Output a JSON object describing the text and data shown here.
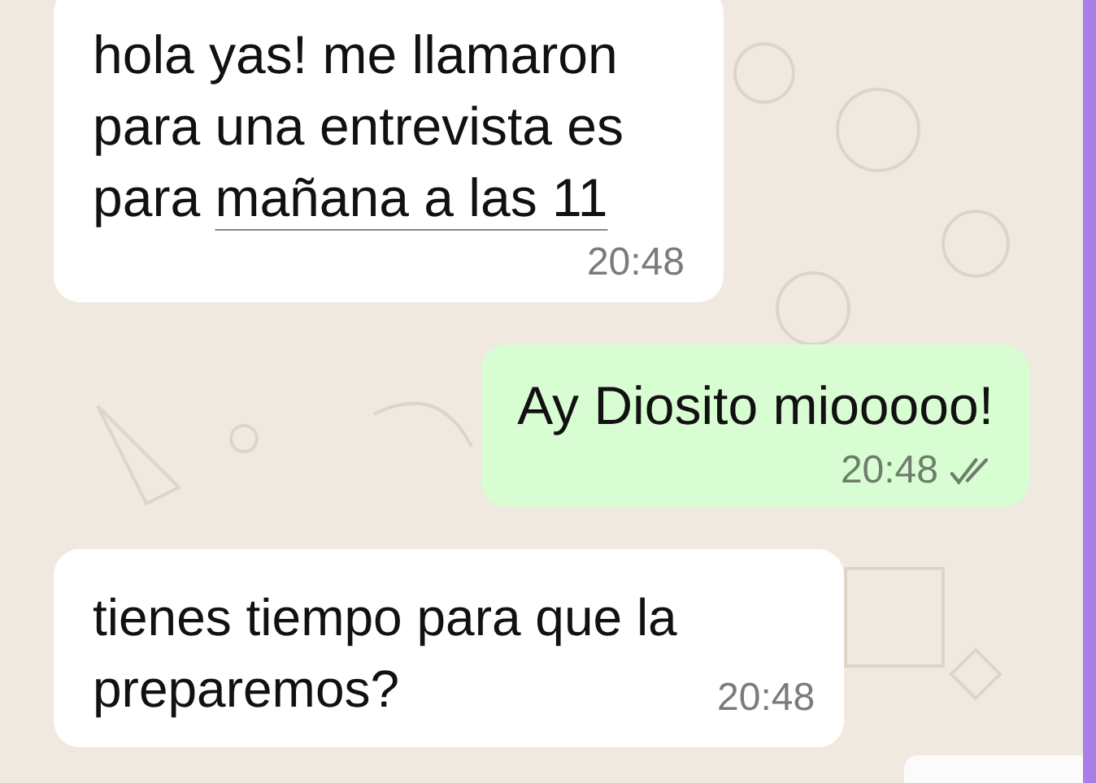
{
  "messages": [
    {
      "outgoing": false,
      "parts": [
        {
          "kind": "plain",
          "text": "hola yas! me llamaron para una entrevista es para "
        },
        {
          "kind": "date-link",
          "text": "mañana a las 11"
        }
      ],
      "time": "20:48"
    },
    {
      "outgoing": true,
      "parts": [
        {
          "kind": "plain",
          "text": "Ay Diosito miooooo!"
        }
      ],
      "time": "20:48",
      "read": false
    },
    {
      "outgoing": false,
      "parts": [
        {
          "kind": "plain",
          "text": "tienes tiempo para que la preparemos?"
        }
      ],
      "time": "20:48"
    }
  ]
}
